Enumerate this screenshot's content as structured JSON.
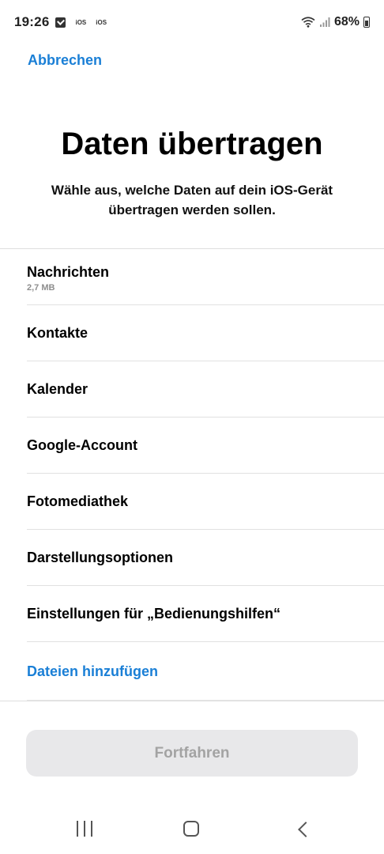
{
  "status_bar": {
    "time": "19:26",
    "badge_1": "iOS",
    "badge_2": "iOS",
    "battery": "68%",
    "icons": [
      "check-notification-icon",
      "wifi-icon",
      "signal-icon",
      "battery-icon"
    ]
  },
  "header": {
    "cancel_label": "Abbrechen",
    "title": "Daten übertragen",
    "subtitle": "Wähle aus, welche Daten auf dein iOS-Gerät übertragen werden sollen."
  },
  "list": {
    "items": [
      {
        "label": "Nachrichten",
        "sub": "2,7 MB"
      },
      {
        "label": "Kontakte"
      },
      {
        "label": "Kalender"
      },
      {
        "label": "Google-Account"
      },
      {
        "label": "Fotomediathek"
      },
      {
        "label": "Darstellungsoptionen"
      },
      {
        "label": "Einstellungen für „Bedienungshilfen“"
      }
    ],
    "add_files_label": "Dateien hinzufügen"
  },
  "footer": {
    "continue_label": "Fortfahren"
  },
  "colors": {
    "accent": "#1a7fd6",
    "disabled_button_bg": "#e8e8ea",
    "disabled_button_text": "#a3a3a3"
  }
}
